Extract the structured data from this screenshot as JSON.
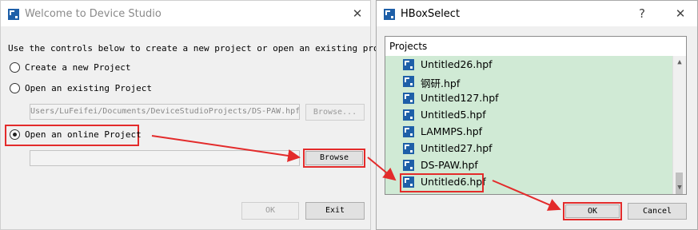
{
  "welcome_dialog": {
    "title": "Welcome to Device Studio",
    "close_symbol": "✕",
    "instruction": "Use the controls below to create a new project or open an existing project",
    "options": [
      {
        "label": "Create a new Project",
        "checked": false
      },
      {
        "label": "Open an existing Project",
        "checked": false
      },
      {
        "label": "Open an online Project",
        "checked": true
      }
    ],
    "existing_path": "Users/LuFeifei/Documents/DeviceStudioProjects/DS-PAW.hpf",
    "existing_browse_label": "Browse...",
    "online_path": "",
    "online_browse_label": "Browse",
    "ok_label": "OK",
    "exit_label": "Exit"
  },
  "hbox_dialog": {
    "title": "HBoxSelect",
    "help_symbol": "?",
    "close_symbol": "✕",
    "list_header": "Projects",
    "projects": [
      "Untitled26.hpf",
      "钢研.hpf",
      "Untitled127.hpf",
      "Untitled5.hpf",
      "LAMMPS.hpf",
      "Untitled27.hpf",
      "DS-PAW.hpf",
      "Untitled6.hpf"
    ],
    "selected_project": "Untitled6.hpf",
    "ok_label": "OK",
    "cancel_label": "Cancel",
    "scroll_up": "▲",
    "scroll_down": "▼"
  },
  "colors": {
    "highlight_red": "#e32b2b",
    "list_green": "#d0ead5",
    "app_icon_blue": "#1e5fa8"
  },
  "icons": {
    "app": "device-studio-icon",
    "file": "hpf-file-icon"
  }
}
